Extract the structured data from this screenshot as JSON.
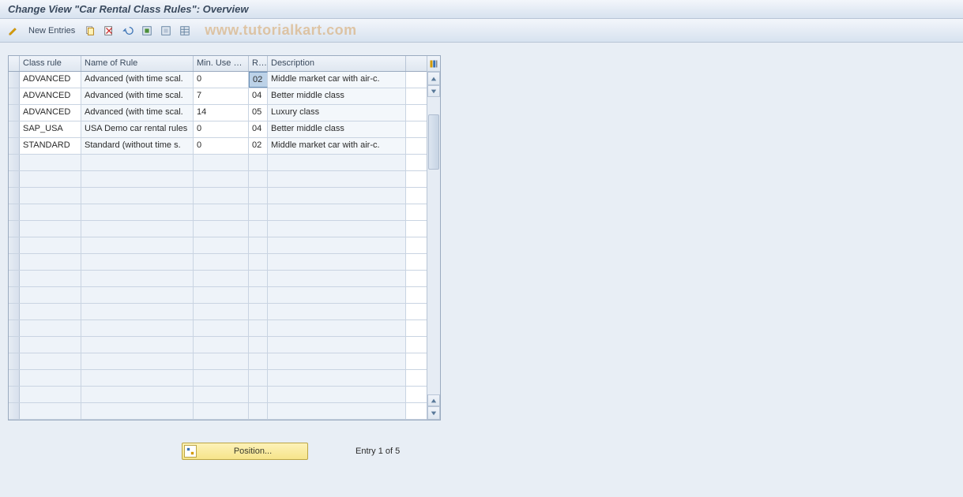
{
  "title": "Change View \"Car Rental Class Rules\": Overview",
  "toolbar": {
    "new_entries": "New Entries",
    "watermark": "www.tutorialkart.com"
  },
  "grid": {
    "columns": {
      "class_rule": "Class rule",
      "name": "Name of Rule",
      "min_use": "Min. Use D...",
      "r": "R...",
      "description": "Description"
    },
    "rows": [
      {
        "class_rule": "ADVANCED",
        "name": "Advanced (with time scal.",
        "min_use": "0",
        "r": "02",
        "description": "Middle market car with air-c."
      },
      {
        "class_rule": "ADVANCED",
        "name": "Advanced (with time scal.",
        "min_use": "7",
        "r": "04",
        "description": "Better middle class"
      },
      {
        "class_rule": "ADVANCED",
        "name": "Advanced (with time scal.",
        "min_use": "14",
        "r": "05",
        "description": "Luxury class"
      },
      {
        "class_rule": "SAP_USA",
        "name": "USA Demo car rental rules",
        "min_use": "0",
        "r": "04",
        "description": "Better middle class"
      },
      {
        "class_rule": "STANDARD",
        "name": "Standard (without time s.",
        "min_use": "0",
        "r": "02",
        "description": "Middle market car with air-c."
      }
    ],
    "empty_rows": 16
  },
  "footer": {
    "position_label": "Position...",
    "entry_status": "Entry 1 of 5"
  }
}
